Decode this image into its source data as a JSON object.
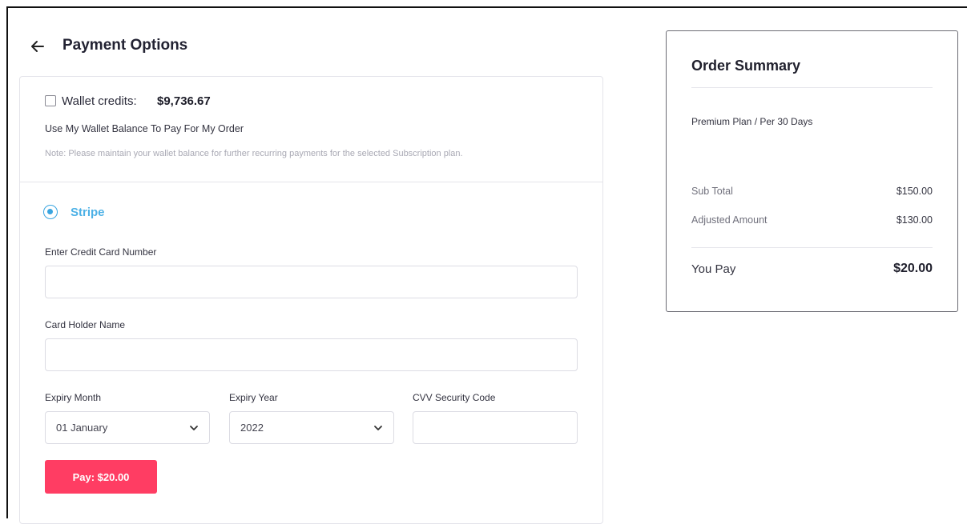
{
  "header": {
    "title": "Payment Options"
  },
  "wallet": {
    "label": "Wallet credits:",
    "amount": "$9,736.67",
    "use_text": "Use My Wallet Balance To Pay For My Order",
    "note": "Note: Please maintain your wallet balance for further recurring payments for the selected Subscription plan.",
    "checked": false
  },
  "stripe": {
    "label": "Stripe",
    "selected": true
  },
  "form": {
    "card_number_label": "Enter Credit Card Number",
    "card_number_value": "",
    "holder_label": "Card Holder Name",
    "holder_value": "",
    "expiry_month_label": "Expiry Month",
    "expiry_month_value": "01 January",
    "expiry_year_label": "Expiry Year",
    "expiry_year_value": "2022",
    "cvv_label": "CVV Security Code",
    "cvv_value": ""
  },
  "pay_button": {
    "label": "Pay: $20.00"
  },
  "summary": {
    "title": "Order Summary",
    "plan": "Premium Plan / Per 30 Days",
    "rows": [
      {
        "label": "Sub Total",
        "value": "$150.00"
      },
      {
        "label": "Adjusted Amount",
        "value": "$130.00"
      }
    ],
    "you_pay_label": "You Pay",
    "you_pay_value": "$20.00"
  },
  "colors": {
    "accent": "#4db1e6",
    "pay_button": "#ff3d63"
  },
  "icons": [
    "arrow-left-icon",
    "chevron-down-icon"
  ]
}
